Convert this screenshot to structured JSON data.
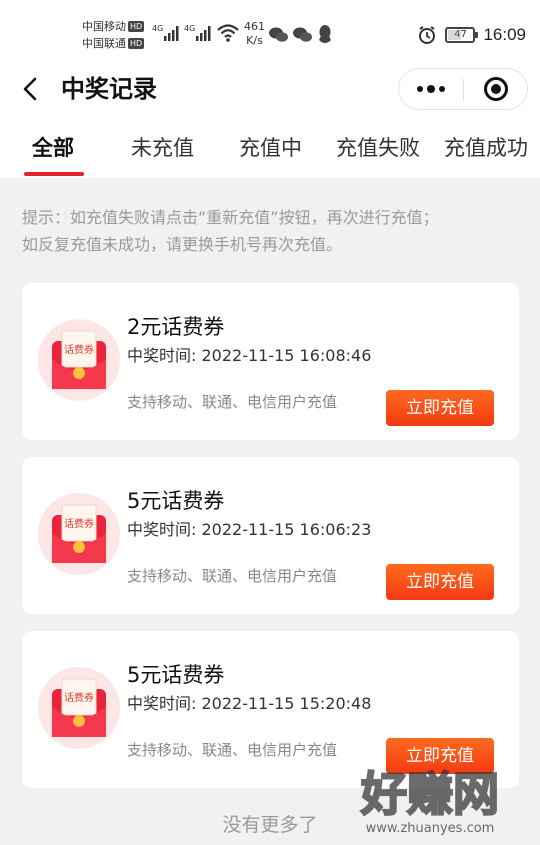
{
  "status_bar": {
    "carrier1": "中国移动",
    "carrier2": "中国联通",
    "hd": "HD",
    "net1": "4G",
    "net2": "4G",
    "speed_value": "461",
    "speed_unit": "K/s",
    "battery": "47",
    "time": "16:09"
  },
  "header": {
    "title": "中奖记录"
  },
  "tabs": [
    {
      "label": "全部",
      "active": true
    },
    {
      "label": "未充值",
      "active": false
    },
    {
      "label": "充值中",
      "active": false
    },
    {
      "label": "充值失败",
      "active": false
    },
    {
      "label": "充值成功",
      "active": false
    }
  ],
  "tip": {
    "line1": "提示：如充值失败请点击“重新充值”按钮，再次进行充值；",
    "line2": "如反复充值未成功，请更换手机号再次充值。"
  },
  "records": [
    {
      "thumb_label": "话费券",
      "title": "2元话费券",
      "time": "中奖时间: 2022-11-15 16:08:46",
      "desc": "支持移动、联通、电信用户充值",
      "button": "立即充值"
    },
    {
      "thumb_label": "话费券",
      "title": "5元话费券",
      "time": "中奖时间: 2022-11-15 16:06:23",
      "desc": "支持移动、联通、电信用户充值",
      "button": "立即充值"
    },
    {
      "thumb_label": "话费券",
      "title": "5元话费券",
      "time": "中奖时间: 2022-11-15 15:20:48",
      "desc": "支持移动、联通、电信用户充值",
      "button": "立即充值"
    }
  ],
  "footer": {
    "no_more": "没有更多了"
  },
  "watermark": {
    "brand": "好赚网",
    "url": "www.zhuanyes.com"
  },
  "colors": {
    "accent": "#e5202e",
    "button": "#f4481a",
    "background": "#f1f1f3"
  }
}
